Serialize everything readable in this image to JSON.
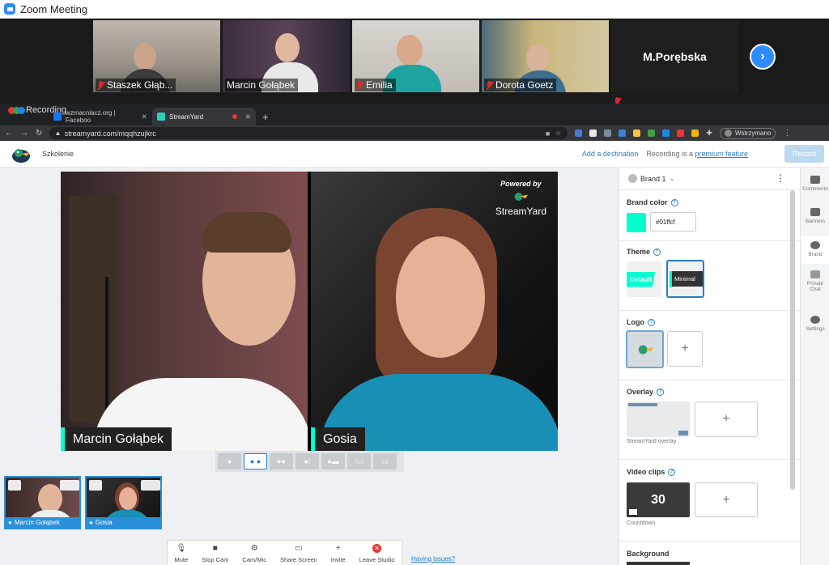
{
  "zoom": {
    "title": "Zoom Meeting",
    "participants": [
      {
        "name": "Staszek Głąb..."
      },
      {
        "name": "Marcin Gołąbek"
      },
      {
        "name": "Emilia"
      },
      {
        "name": "Dorota Goetz"
      },
      {
        "name": "M.Porębska"
      }
    ]
  },
  "browser": {
    "recording_label": "Recording",
    "tabs": [
      {
        "label": "wzmacniacz.org | Faceboo"
      },
      {
        "label": "StreamYard"
      }
    ],
    "url": "streamyard.com/mqqhzujkrc",
    "profile_label": "Wstrzymano"
  },
  "streamyard": {
    "broadcast_title": "Szkolenie",
    "add_destination": "Add a destination",
    "recording_text": "Recording is a",
    "premium_link": "premium feature",
    "record_button": "Record",
    "powered_by": "Powered by",
    "brand_text": "StreamYard",
    "stage": [
      {
        "name": "Marcin Gołąbek"
      },
      {
        "name": "Gosia"
      }
    ],
    "backstage": [
      {
        "name": "Marcin Gołąbek"
      },
      {
        "name": "Gosia"
      }
    ],
    "controls": [
      "Mute",
      "Stop Cam",
      "Cam/Mic",
      "Share Screen",
      "Invite",
      "Leave Studio"
    ],
    "having_issues": "Having issues?"
  },
  "panel": {
    "brand_name": "Brand 1",
    "brand_color_title": "Brand color",
    "brand_color_value": "#01ffcf",
    "theme_title": "Theme",
    "themes": [
      "Default",
      "Minimal"
    ],
    "logo_title": "Logo",
    "overlay_title": "Overlay",
    "overlay_caption": "StreamYard overlay",
    "video_clips_title": "Video clips",
    "clip_number": "30",
    "clip_caption": "Countdown",
    "background_title": "Background"
  },
  "rail": [
    "Comments",
    "Banners",
    "Brand",
    "Private Chat",
    "Settings"
  ],
  "colors": {
    "accent": "#01ffcf",
    "link": "#2a7ec4",
    "zoom_blue": "#2d8cff"
  }
}
